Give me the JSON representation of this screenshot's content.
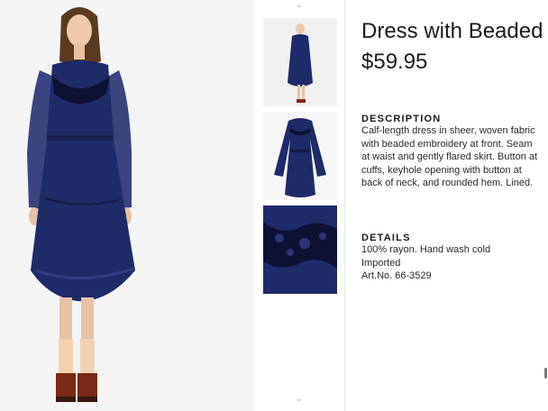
{
  "product": {
    "title": "Dress with Beaded",
    "price": "$59.95"
  },
  "description": {
    "heading": "DESCRIPTION",
    "text": "Calf-length dress in sheer, woven fabric with beaded embroidery at front. Seam at waist and gently flared skirt. Button at cuffs, keyhole opening with button at back of neck, and rounded hem. Lined."
  },
  "details": {
    "heading": "DETAILS",
    "lines": [
      "100% rayon. Hand wash cold",
      "Imported",
      "Art.No. 66-3529"
    ]
  },
  "gallery": {
    "up_arrow": "chevron-up-icon",
    "down_arrow": "chevron-down-icon",
    "arrow_up_glyph": "⌃",
    "arrow_down_glyph": "⌄"
  },
  "colors": {
    "dress_navy": "#1f2a68",
    "dress_dark": "#141b45",
    "background": "#f4f4f4",
    "skin": "#e9c7ad",
    "hair": "#5a3b22"
  }
}
